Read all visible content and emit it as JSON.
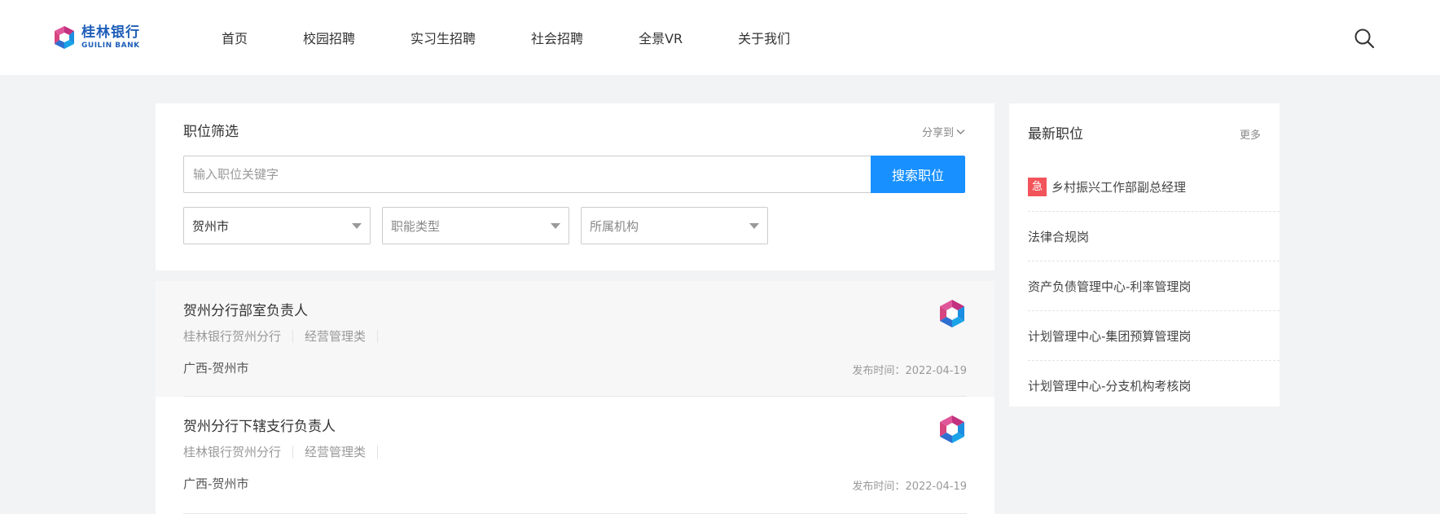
{
  "brand": {
    "name_cn": "桂林银行",
    "name_en": "GUILIN BANK"
  },
  "nav": {
    "items": [
      {
        "label": "首页"
      },
      {
        "label": "校园招聘"
      },
      {
        "label": "实习生招聘"
      },
      {
        "label": "社会招聘"
      },
      {
        "label": "全景VR"
      },
      {
        "label": "关于我们"
      }
    ],
    "search_icon": "search-icon"
  },
  "filter": {
    "title": "职位筛选",
    "share_label": "分享到",
    "keyword_placeholder": "输入职位关键字",
    "keyword_value": "",
    "search_button": "搜索职位",
    "city_selected": "贺州市",
    "function_placeholder": "职能类型",
    "org_placeholder": "所属机构"
  },
  "jobs": [
    {
      "title": "贺州分行部室负责人",
      "org": "桂林银行贺州分行",
      "category": "经营管理类",
      "location": "广西-贺州市",
      "date_label": "发布时间：",
      "date": "2022-04-19"
    },
    {
      "title": "贺州分行下辖支行负责人",
      "org": "桂林银行贺州分行",
      "category": "经营管理类",
      "location": "广西-贺州市",
      "date_label": "发布时间：",
      "date": "2022-04-19"
    }
  ],
  "latest": {
    "title": "最新职位",
    "more_label": "更多",
    "urgent_badge": "急",
    "items": [
      {
        "label": "乡村振兴工作部副总经理",
        "urgent": true
      },
      {
        "label": "法律合规岗",
        "urgent": false
      },
      {
        "label": "资产负债管理中心-利率管理岗",
        "urgent": false
      },
      {
        "label": "计划管理中心-集团预算管理岗",
        "urgent": false
      },
      {
        "label": "计划管理中心-分支机构考核岗",
        "urgent": false
      }
    ]
  },
  "colors": {
    "accent": "#1890ff",
    "urgent": "#f2545b",
    "logo_magenta": "#c2317f",
    "logo_blue": "#1a8ee0"
  }
}
